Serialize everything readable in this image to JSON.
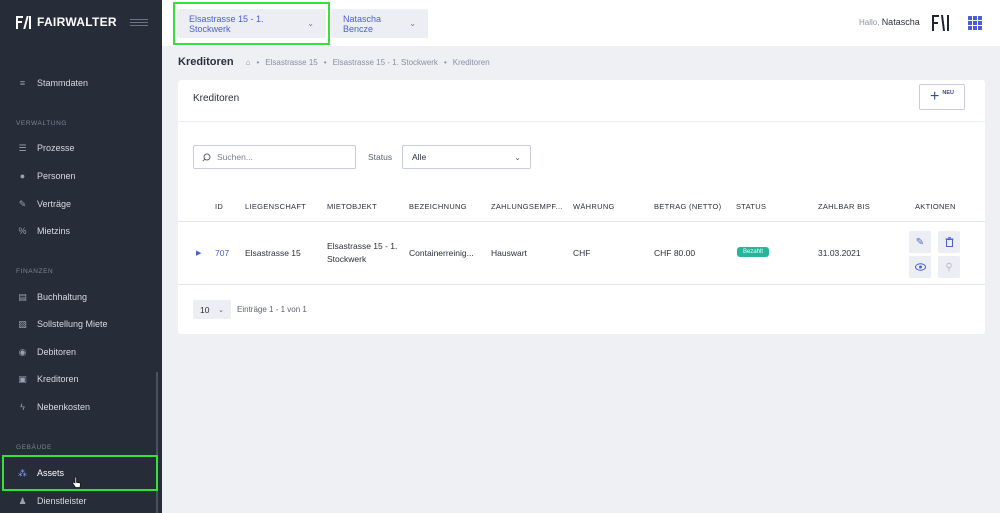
{
  "app": {
    "name": "FAIRWALTER"
  },
  "sidebar": {
    "items": [
      {
        "label": "Stammdaten",
        "icon": "database-icon"
      },
      {
        "section": "VERWALTUNG"
      },
      {
        "label": "Prozesse",
        "icon": "list-icon"
      },
      {
        "label": "Personen",
        "icon": "users-icon"
      },
      {
        "label": "Verträge",
        "icon": "contract-icon"
      },
      {
        "label": "Mietzins",
        "icon": "percent-icon"
      },
      {
        "section": "FINANZEN"
      },
      {
        "label": "Buchhaltung",
        "icon": "ledger-icon"
      },
      {
        "label": "Sollstellung Miete",
        "icon": "invoice-icon"
      },
      {
        "label": "Debitoren",
        "icon": "coins-icon"
      },
      {
        "label": "Kreditoren",
        "icon": "wallet-icon"
      },
      {
        "label": "Nebenkosten",
        "icon": "bolt-icon"
      },
      {
        "section": "GEBÄUDE"
      },
      {
        "label": "Assets",
        "icon": "assets-icon",
        "active": true
      },
      {
        "label": "Dienstleister",
        "icon": "worker-icon"
      }
    ]
  },
  "topbar": {
    "property": "Elsastrasse 15 - 1. Stockwerk",
    "person": "Natascha Bencze",
    "greeting": "Hallo,",
    "user": "Natascha",
    "accent": "#4a5fd6"
  },
  "breadcrumb": {
    "page": "Kreditoren",
    "trail": [
      "Elsastrasse 15",
      "Elsastrasse 15 - 1. Stockwerk",
      "Kreditoren"
    ]
  },
  "card": {
    "title": "Kreditoren",
    "new_label": "NEU",
    "search_placeholder": "Suchen...",
    "status_label": "Status",
    "status_value": "Alle"
  },
  "table": {
    "columns": [
      "ID",
      "LIEGENSCHAFT",
      "MIETOBJEKT",
      "BEZEICHNUNG",
      "ZAHLUNGSEMPF...",
      "WÄHRUNG",
      "BETRAG (NETTO)",
      "STATUS",
      "ZAHLBAR BIS",
      "AKTIONEN"
    ],
    "rows": [
      {
        "id": "707",
        "liegenschaft": "Elsastrasse 15",
        "mietobjekt_1": "Elsastrasse 15 - 1.",
        "mietobjekt_2": "Stockwerk",
        "bezeichnung": "Containerreinig...",
        "empfaenger": "Hauswart",
        "waehrung": "CHF",
        "betrag": "CHF 80.00",
        "status": "Bezahlt",
        "zahlbar_bis": "31.03.2021"
      }
    ]
  },
  "pager": {
    "page_size": "10",
    "info": "Einträge 1 - 1 von 1"
  },
  "colors": {
    "sidebar": "#262c38",
    "highlight": "#35e03a",
    "badge": "#26b59a"
  }
}
